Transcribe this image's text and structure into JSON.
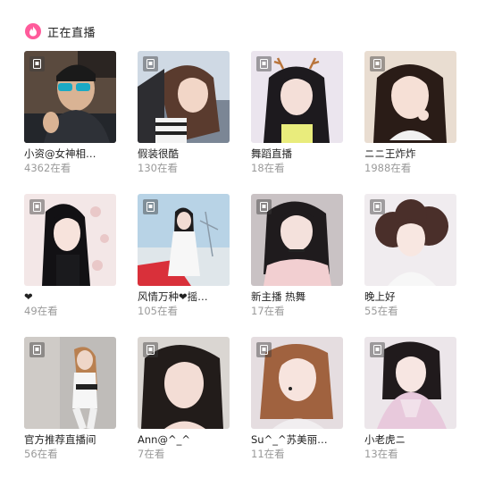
{
  "header": {
    "title": "正在直播",
    "icon": "flame-icon",
    "accent": "#ff5b9b"
  },
  "streams": [
    {
      "title": "小资@女神相…",
      "viewers": "4362在看"
    },
    {
      "title": "假装很酷",
      "viewers": "130在看"
    },
    {
      "title": "舞蹈直播",
      "viewers": "18在看"
    },
    {
      "title": "ニニ王炸炸",
      "viewers": "1988在看"
    },
    {
      "title": "❤",
      "viewers": "49在看"
    },
    {
      "title": "风情万种❤摇…",
      "viewers": "105在看"
    },
    {
      "title": "新主播 热舞",
      "viewers": "17在看"
    },
    {
      "title": "晚上好",
      "viewers": "55在看"
    },
    {
      "title": "官方推荐直播间",
      "viewers": "56在看"
    },
    {
      "title": "Ann@^_^",
      "viewers": "7在看"
    },
    {
      "title": "Su^_^苏美丽…",
      "viewers": "11在看"
    },
    {
      "title": "小老虎ニ",
      "viewers": "13在看"
    }
  ]
}
